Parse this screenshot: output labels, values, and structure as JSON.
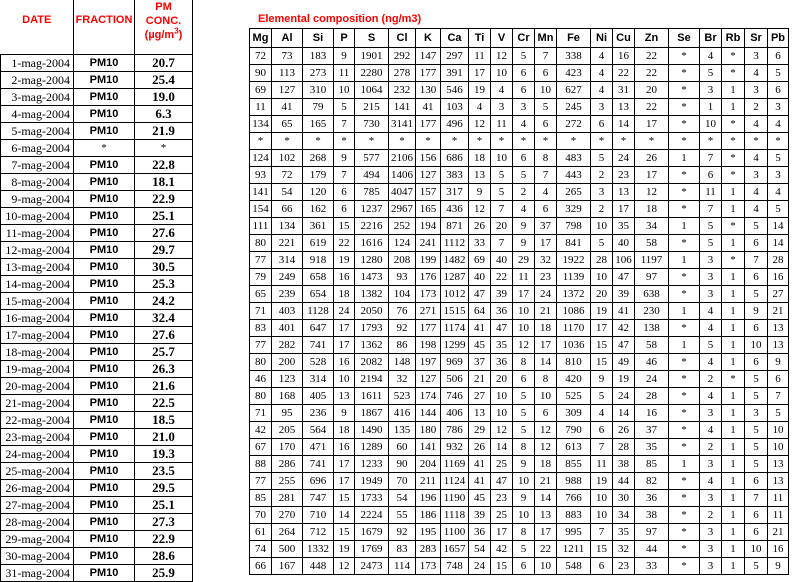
{
  "headers": {
    "date": "DATE",
    "fraction": "FRACTION",
    "conc_line1": "PM",
    "conc_line2": "CONC.",
    "conc_unit_pre": "(µg/m",
    "conc_unit_sup": "3",
    "conc_unit_post": ")"
  },
  "elemental_title": "Elemental composition (ng/m3)",
  "elements": [
    "Mg",
    "Al",
    "Si",
    "P",
    "S",
    "Cl",
    "K",
    "Ca",
    "Ti",
    "V",
    "Cr",
    "Mn",
    "Fe",
    "Ni",
    "Cu",
    "Zn",
    "Se",
    "Br",
    "Rb",
    "Sr",
    "Pb"
  ],
  "rows": [
    {
      "date": "1-mag-2004",
      "fraction": "PM10",
      "conc": "20.7",
      "values": [
        "72",
        "73",
        "183",
        "9",
        "1901",
        "292",
        "147",
        "297",
        "11",
        "12",
        "5",
        "7",
        "338",
        "4",
        "16",
        "22",
        "*",
        "4",
        "*",
        "3",
        "6"
      ]
    },
    {
      "date": "2-mag-2004",
      "fraction": "PM10",
      "conc": "25.4",
      "values": [
        "90",
        "113",
        "273",
        "11",
        "2280",
        "278",
        "177",
        "391",
        "17",
        "10",
        "6",
        "6",
        "423",
        "4",
        "22",
        "22",
        "*",
        "5",
        "*",
        "4",
        "5"
      ]
    },
    {
      "date": "3-mag-2004",
      "fraction": "PM10",
      "conc": "19.0",
      "values": [
        "69",
        "127",
        "310",
        "10",
        "1064",
        "232",
        "130",
        "546",
        "19",
        "4",
        "6",
        "10",
        "627",
        "4",
        "31",
        "20",
        "*",
        "3",
        "1",
        "3",
        "6"
      ]
    },
    {
      "date": "4-mag-2004",
      "fraction": "PM10",
      "conc": "6.3",
      "values": [
        "11",
        "41",
        "79",
        "5",
        "215",
        "141",
        "41",
        "103",
        "4",
        "3",
        "3",
        "5",
        "245",
        "3",
        "13",
        "22",
        "*",
        "1",
        "1",
        "2",
        "3"
      ]
    },
    {
      "date": "5-mag-2004",
      "fraction": "PM10",
      "conc": "21.9",
      "values": [
        "134",
        "65",
        "165",
        "7",
        "730",
        "3141",
        "177",
        "496",
        "12",
        "11",
        "4",
        "6",
        "272",
        "6",
        "14",
        "17",
        "*",
        "10",
        "*",
        "4",
        "4"
      ]
    },
    {
      "date": "6-mag-2004",
      "fraction": "*",
      "conc": "*",
      "values": [
        "*",
        "*",
        "*",
        "*",
        "*",
        "*",
        "*",
        "*",
        "*",
        "*",
        "*",
        "*",
        "*",
        "*",
        "*",
        "*",
        "*",
        "*",
        "*",
        "*",
        "*"
      ]
    },
    {
      "date": "7-mag-2004",
      "fraction": "PM10",
      "conc": "22.8",
      "values": [
        "124",
        "102",
        "268",
        "9",
        "577",
        "2106",
        "156",
        "686",
        "18",
        "10",
        "6",
        "8",
        "483",
        "5",
        "24",
        "26",
        "1",
        "7",
        "*",
        "4",
        "5"
      ]
    },
    {
      "date": "8-mag-2004",
      "fraction": "PM10",
      "conc": "18.1",
      "values": [
        "93",
        "72",
        "179",
        "7",
        "494",
        "1406",
        "127",
        "383",
        "13",
        "5",
        "5",
        "7",
        "443",
        "2",
        "23",
        "17",
        "*",
        "6",
        "*",
        "3",
        "3"
      ]
    },
    {
      "date": "9-mag-2004",
      "fraction": "PM10",
      "conc": "22.9",
      "values": [
        "141",
        "54",
        "120",
        "6",
        "785",
        "4047",
        "157",
        "317",
        "9",
        "5",
        "2",
        "4",
        "265",
        "3",
        "13",
        "12",
        "*",
        "11",
        "1",
        "4",
        "4"
      ]
    },
    {
      "date": "10-mag-2004",
      "fraction": "PM10",
      "conc": "25.1",
      "values": [
        "154",
        "66",
        "162",
        "6",
        "1237",
        "2967",
        "165",
        "436",
        "12",
        "7",
        "4",
        "6",
        "329",
        "2",
        "17",
        "18",
        "*",
        "7",
        "1",
        "4",
        "5"
      ]
    },
    {
      "date": "11-mag-2004",
      "fraction": "PM10",
      "conc": "27.6",
      "values": [
        "111",
        "134",
        "361",
        "15",
        "2216",
        "252",
        "194",
        "871",
        "26",
        "20",
        "9",
        "37",
        "798",
        "10",
        "35",
        "34",
        "1",
        "5",
        "*",
        "5",
        "14"
      ]
    },
    {
      "date": "12-mag-2004",
      "fraction": "PM10",
      "conc": "29.7",
      "values": [
        "80",
        "221",
        "619",
        "22",
        "1616",
        "124",
        "241",
        "1112",
        "33",
        "7",
        "9",
        "17",
        "841",
        "5",
        "40",
        "58",
        "*",
        "5",
        "1",
        "6",
        "14"
      ]
    },
    {
      "date": "13-mag-2004",
      "fraction": "PM10",
      "conc": "30.5",
      "values": [
        "77",
        "314",
        "918",
        "19",
        "1280",
        "208",
        "199",
        "1482",
        "69",
        "40",
        "29",
        "32",
        "1922",
        "28",
        "106",
        "1197",
        "1",
        "3",
        "*",
        "7",
        "28"
      ]
    },
    {
      "date": "14-mag-2004",
      "fraction": "PM10",
      "conc": "25.3",
      "values": [
        "79",
        "249",
        "658",
        "16",
        "1473",
        "93",
        "176",
        "1287",
        "40",
        "22",
        "11",
        "23",
        "1139",
        "10",
        "47",
        "97",
        "*",
        "3",
        "1",
        "6",
        "16"
      ]
    },
    {
      "date": "15-mag-2004",
      "fraction": "PM10",
      "conc": "24.2",
      "values": [
        "65",
        "239",
        "654",
        "18",
        "1382",
        "104",
        "173",
        "1012",
        "47",
        "39",
        "17",
        "24",
        "1372",
        "20",
        "39",
        "638",
        "*",
        "3",
        "1",
        "5",
        "27"
      ]
    },
    {
      "date": "16-mag-2004",
      "fraction": "PM10",
      "conc": "32.4",
      "values": [
        "71",
        "403",
        "1128",
        "24",
        "2050",
        "76",
        "271",
        "1515",
        "64",
        "36",
        "10",
        "21",
        "1086",
        "19",
        "41",
        "230",
        "1",
        "4",
        "1",
        "9",
        "21"
      ]
    },
    {
      "date": "17-mag-2004",
      "fraction": "PM10",
      "conc": "27.6",
      "values": [
        "83",
        "401",
        "647",
        "17",
        "1793",
        "92",
        "177",
        "1174",
        "41",
        "47",
        "10",
        "18",
        "1170",
        "17",
        "42",
        "138",
        "*",
        "4",
        "1",
        "6",
        "13"
      ]
    },
    {
      "date": "18-mag-2004",
      "fraction": "PM10",
      "conc": "25.7",
      "values": [
        "77",
        "282",
        "741",
        "17",
        "1362",
        "86",
        "198",
        "1299",
        "45",
        "35",
        "12",
        "17",
        "1036",
        "15",
        "47",
        "58",
        "1",
        "5",
        "1",
        "10",
        "13"
      ]
    },
    {
      "date": "19-mag-2004",
      "fraction": "PM10",
      "conc": "26.3",
      "values": [
        "80",
        "200",
        "528",
        "16",
        "2082",
        "148",
        "197",
        "969",
        "37",
        "36",
        "8",
        "14",
        "810",
        "15",
        "49",
        "46",
        "*",
        "4",
        "1",
        "6",
        "9"
      ]
    },
    {
      "date": "20-mag-2004",
      "fraction": "PM10",
      "conc": "21.6",
      "values": [
        "46",
        "123",
        "314",
        "10",
        "2194",
        "32",
        "127",
        "506",
        "21",
        "20",
        "6",
        "8",
        "420",
        "9",
        "19",
        "24",
        "*",
        "2",
        "*",
        "5",
        "6"
      ]
    },
    {
      "date": "21-mag-2004",
      "fraction": "PM10",
      "conc": "22.5",
      "values": [
        "80",
        "168",
        "405",
        "13",
        "1611",
        "523",
        "174",
        "746",
        "27",
        "10",
        "5",
        "10",
        "525",
        "5",
        "24",
        "28",
        "*",
        "4",
        "1",
        "5",
        "7"
      ]
    },
    {
      "date": "22-mag-2004",
      "fraction": "PM10",
      "conc": "18.5",
      "values": [
        "71",
        "95",
        "236",
        "9",
        "1867",
        "416",
        "144",
        "406",
        "13",
        "10",
        "5",
        "6",
        "309",
        "4",
        "14",
        "16",
        "*",
        "3",
        "1",
        "3",
        "5"
      ]
    },
    {
      "date": "23-mag-2004",
      "fraction": "PM10",
      "conc": "21.0",
      "values": [
        "42",
        "205",
        "564",
        "18",
        "1490",
        "135",
        "180",
        "786",
        "29",
        "12",
        "5",
        "12",
        "790",
        "6",
        "26",
        "37",
        "*",
        "4",
        "1",
        "5",
        "10"
      ]
    },
    {
      "date": "24-mag-2004",
      "fraction": "PM10",
      "conc": "19.3",
      "values": [
        "67",
        "170",
        "471",
        "16",
        "1289",
        "60",
        "141",
        "932",
        "26",
        "14",
        "8",
        "12",
        "613",
        "7",
        "28",
        "35",
        "*",
        "2",
        "1",
        "5",
        "10"
      ]
    },
    {
      "date": "25-mag-2004",
      "fraction": "PM10",
      "conc": "23.5",
      "values": [
        "88",
        "286",
        "741",
        "17",
        "1233",
        "90",
        "204",
        "1169",
        "41",
        "25",
        "9",
        "18",
        "855",
        "11",
        "38",
        "85",
        "1",
        "3",
        "1",
        "5",
        "13"
      ]
    },
    {
      "date": "26-mag-2004",
      "fraction": "PM10",
      "conc": "29.5",
      "values": [
        "77",
        "255",
        "696",
        "17",
        "1949",
        "70",
        "211",
        "1124",
        "41",
        "47",
        "10",
        "21",
        "988",
        "19",
        "44",
        "82",
        "*",
        "4",
        "1",
        "6",
        "13"
      ]
    },
    {
      "date": "27-mag-2004",
      "fraction": "PM10",
      "conc": "25.1",
      "values": [
        "85",
        "281",
        "747",
        "15",
        "1733",
        "54",
        "196",
        "1190",
        "45",
        "23",
        "9",
        "14",
        "766",
        "10",
        "30",
        "36",
        "*",
        "3",
        "1",
        "7",
        "11"
      ]
    },
    {
      "date": "28-mag-2004",
      "fraction": "PM10",
      "conc": "27.3",
      "values": [
        "70",
        "270",
        "710",
        "14",
        "2224",
        "55",
        "186",
        "1118",
        "39",
        "25",
        "10",
        "13",
        "883",
        "10",
        "34",
        "38",
        "*",
        "2",
        "1",
        "6",
        "11"
      ]
    },
    {
      "date": "29-mag-2004",
      "fraction": "PM10",
      "conc": "22.9",
      "values": [
        "61",
        "264",
        "712",
        "15",
        "1679",
        "92",
        "195",
        "1100",
        "36",
        "17",
        "8",
        "17",
        "995",
        "7",
        "35",
        "97",
        "*",
        "3",
        "1",
        "6",
        "21"
      ]
    },
    {
      "date": "30-mag-2004",
      "fraction": "PM10",
      "conc": "28.6",
      "values": [
        "74",
        "500",
        "1332",
        "19",
        "1769",
        "83",
        "283",
        "1657",
        "54",
        "42",
        "5",
        "22",
        "1211",
        "15",
        "32",
        "44",
        "*",
        "3",
        "1",
        "10",
        "16"
      ]
    },
    {
      "date": "31-mag-2004",
      "fraction": "PM10",
      "conc": "25.9",
      "values": [
        "66",
        "167",
        "448",
        "12",
        "2473",
        "114",
        "173",
        "748",
        "24",
        "15",
        "6",
        "10",
        "548",
        "6",
        "23",
        "33",
        "*",
        "3",
        "1",
        "5",
        "9"
      ]
    }
  ]
}
